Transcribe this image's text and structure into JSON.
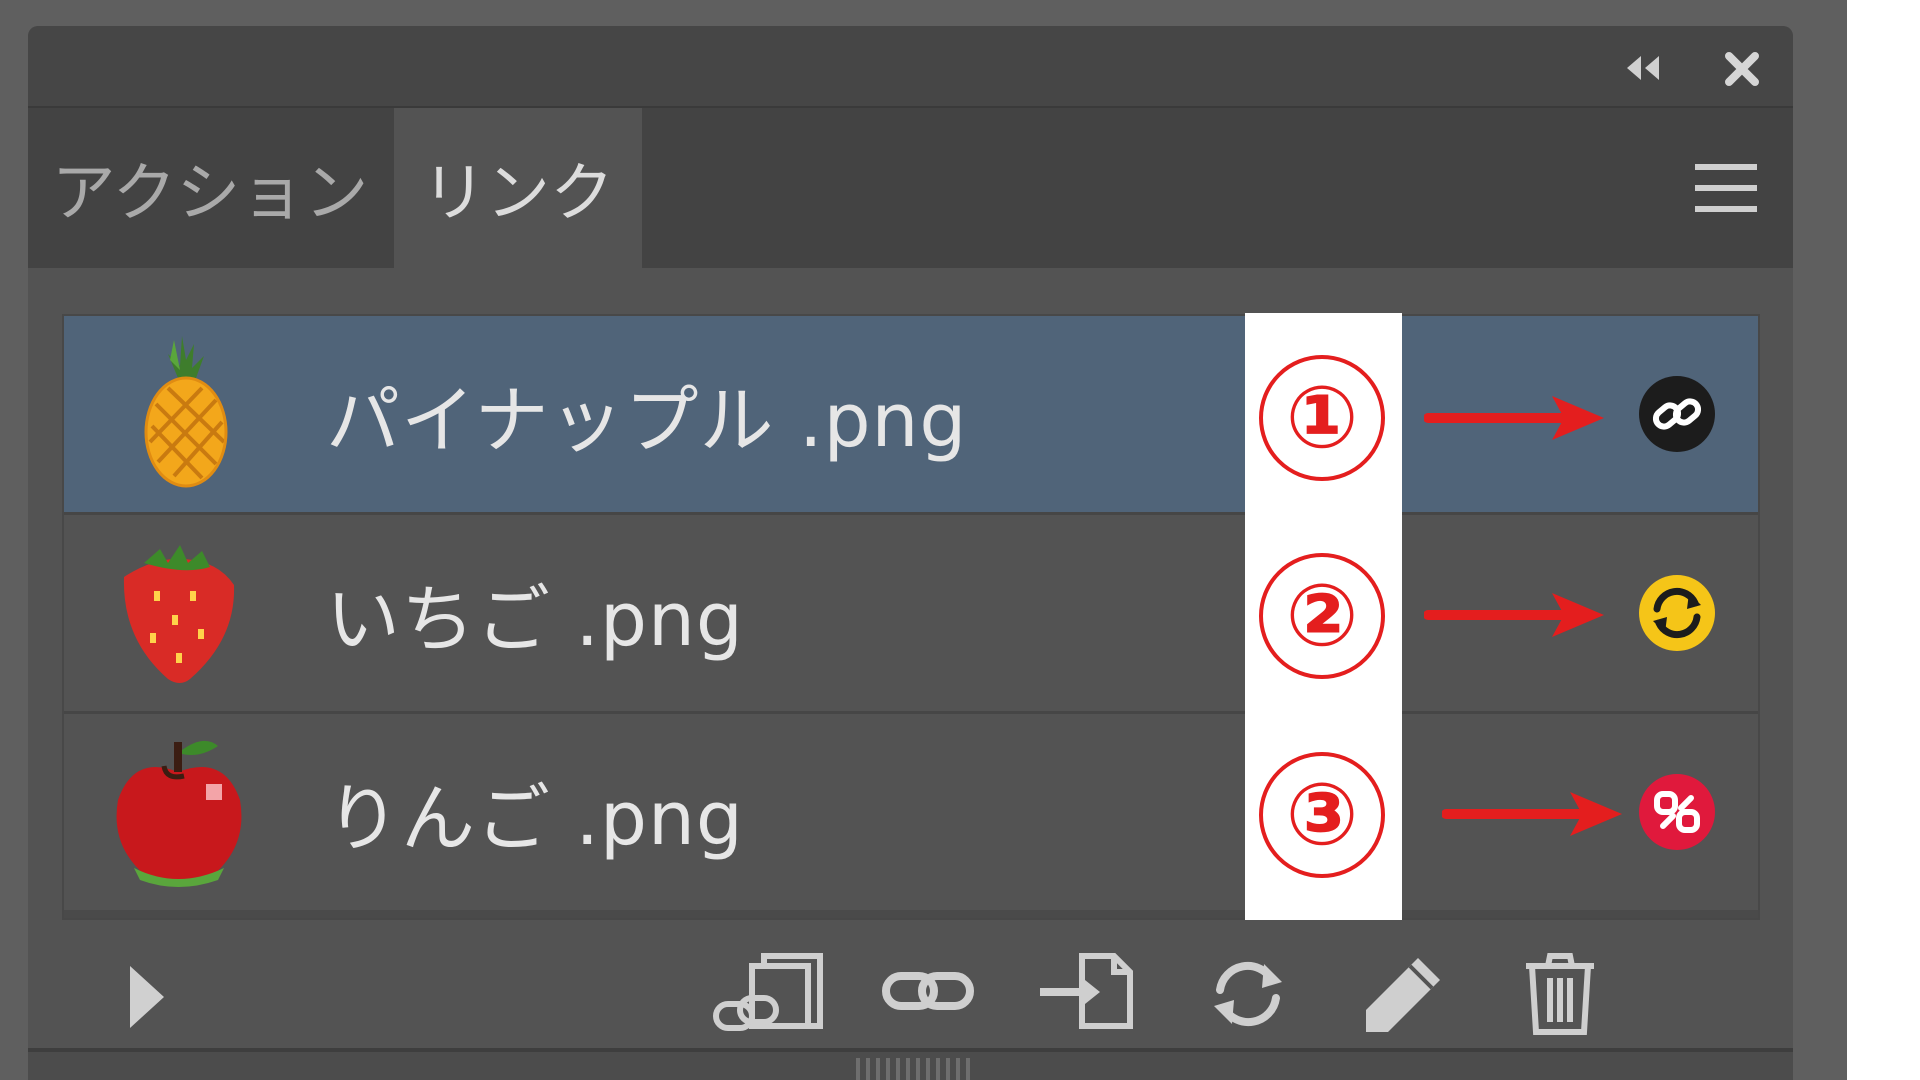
{
  "panel": {
    "tabs": [
      {
        "label": "アクション",
        "active": false
      },
      {
        "label": "リンク",
        "active": true
      }
    ],
    "title_bar_icons": [
      "collapse-panels-icon",
      "close-icon"
    ],
    "menu_icon": "panel-menu-icon"
  },
  "links": [
    {
      "name": "パイナップル .png",
      "thumbnail": "pineapple-thumbnail",
      "status_icon": "linked-icon",
      "status_color": "#1c1c1c",
      "selected": true
    },
    {
      "name": "いちご .png",
      "thumbnail": "strawberry-thumbnail",
      "status_icon": "modified-update-icon",
      "status_color": "#f5c518",
      "selected": false
    },
    {
      "name": "りんご .png",
      "thumbnail": "apple-thumbnail",
      "status_icon": "missing-link-icon",
      "status_color": "#e0193c",
      "selected": false
    }
  ],
  "annotations": {
    "labels": [
      "①",
      "②",
      "③"
    ],
    "color": "#e41e1e"
  },
  "toolbar": {
    "items": [
      {
        "name": "show-options-icon"
      },
      {
        "name": "embed-icon"
      },
      {
        "name": "relink-icon"
      },
      {
        "name": "go-to-link-icon"
      },
      {
        "name": "update-link-icon"
      },
      {
        "name": "edit-original-icon"
      },
      {
        "name": "delete-icon"
      }
    ]
  },
  "colors": {
    "panel_bg": "#535353",
    "selected_row": "#506479",
    "text": "#e6e6e6"
  }
}
